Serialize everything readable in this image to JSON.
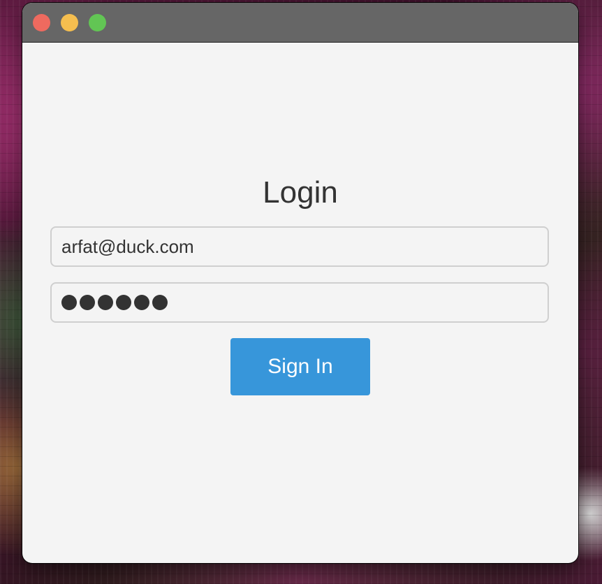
{
  "window": {
    "controls": {
      "close_icon": "close-traffic-light",
      "minimize_icon": "minimize-traffic-light",
      "zoom_icon": "zoom-traffic-light"
    }
  },
  "login": {
    "title": "Login",
    "email_value": "arfat@duck.com",
    "password_masked_length": 6,
    "sign_in_label": "Sign In"
  },
  "colors": {
    "close": "#ee6a5f",
    "minimize": "#f5be4f",
    "zoom": "#62c554",
    "titlebar": "#666666",
    "button": "#3796da",
    "text": "#333333"
  }
}
